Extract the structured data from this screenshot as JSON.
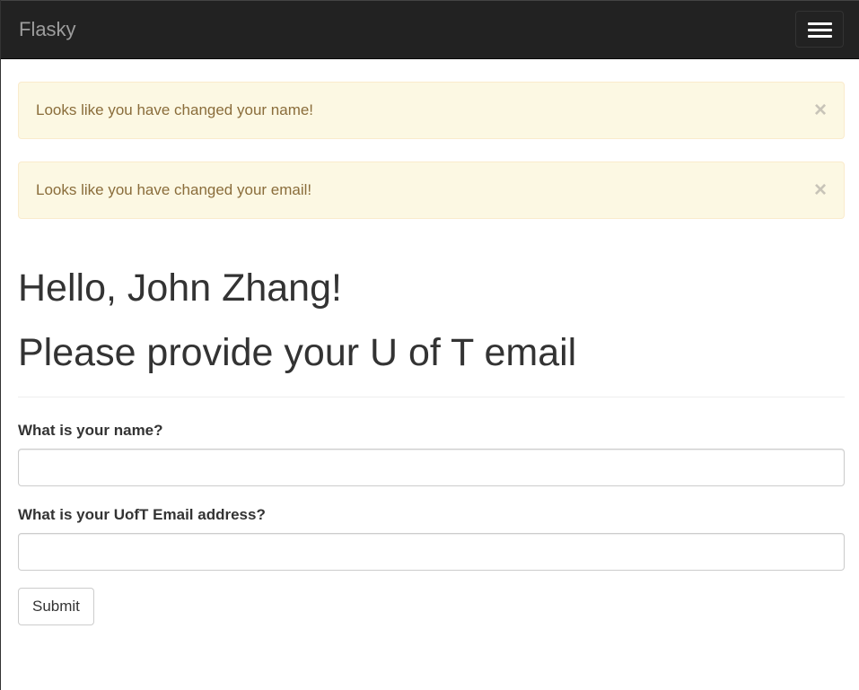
{
  "navbar": {
    "brand": "Flasky",
    "toggle_icon": "hamburger-icon"
  },
  "alerts": [
    {
      "message": "Looks like you have changed your name!",
      "close": "×"
    },
    {
      "message": "Looks like you have changed your email!",
      "close": "×"
    }
  ],
  "header": {
    "greeting": "Hello, John Zhang!",
    "prompt": "Please provide your U of T email"
  },
  "form": {
    "name_label": "What is your name?",
    "name_value": "",
    "email_label": "What is your UofT Email address?",
    "email_value": "",
    "submit_label": "Submit"
  }
}
